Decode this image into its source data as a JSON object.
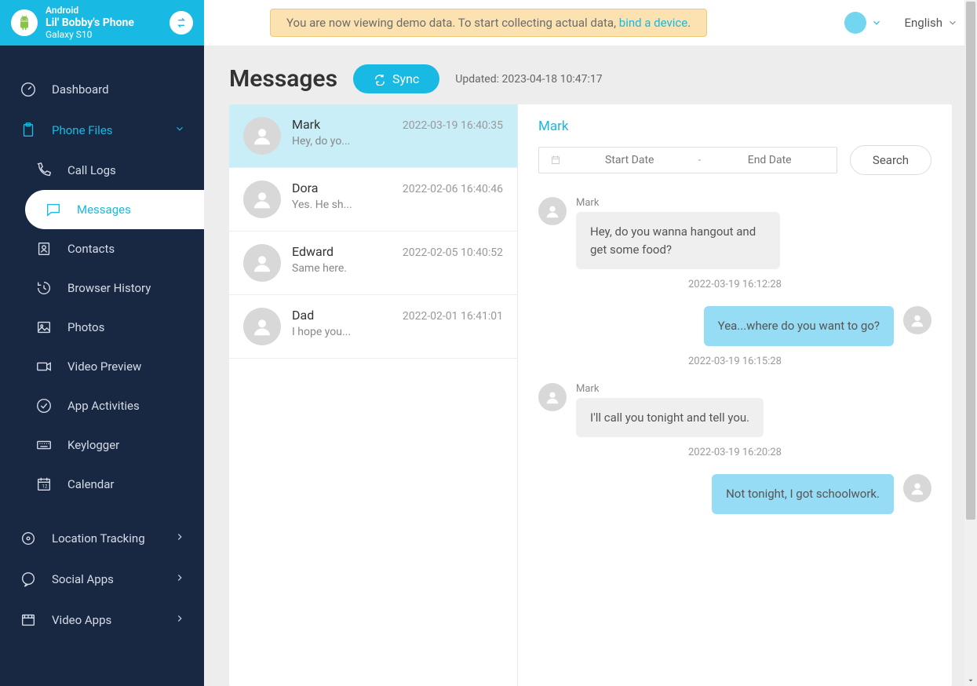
{
  "device": {
    "os": "Android",
    "name": "Lil' Bobby's Phone",
    "model": "Galaxy S10"
  },
  "topbar": {
    "demo_prefix": "You are now viewing demo data. To start collecting actual data, ",
    "demo_link": "bind a device",
    "demo_suffix": ".",
    "language": "English"
  },
  "nav": {
    "dashboard": "Dashboard",
    "phone_files": "Phone Files",
    "call_logs": "Call Logs",
    "messages": "Messages",
    "contacts": "Contacts",
    "browser_history": "Browser History",
    "photos": "Photos",
    "video_preview": "Video Preview",
    "app_activities": "App Activities",
    "keylogger": "Keylogger",
    "calendar": "Calendar",
    "location_tracking": "Location Tracking",
    "social_apps": "Social Apps",
    "video_apps": "Video Apps"
  },
  "page": {
    "title": "Messages",
    "sync": "Sync",
    "updated": "Updated: 2023-04-18 10:47:17"
  },
  "threads": [
    {
      "name": "Mark",
      "preview": "Hey, do yo...",
      "time": "2022-03-19 16:40:35"
    },
    {
      "name": "Dora",
      "preview": "Yes. He sh...",
      "time": "2022-02-06 16:40:46"
    },
    {
      "name": "Edward",
      "preview": "Same here.",
      "time": "2022-02-05 10:40:52"
    },
    {
      "name": "Dad",
      "preview": "I hope you...",
      "time": "2022-02-01 16:41:01"
    }
  ],
  "chat": {
    "contact": "Mark",
    "start_ph": "Start Date",
    "end_ph": "End Date",
    "search": "Search",
    "messages": [
      {
        "dir": "in",
        "sender": "Mark",
        "text": "Hey, do you wanna hangout and get some food?",
        "ts": "2022-03-19 16:12:28"
      },
      {
        "dir": "out",
        "text": "Yea...where do you want to go?",
        "ts": "2022-03-19 16:15:28"
      },
      {
        "dir": "in",
        "sender": "Mark",
        "text": "I'll call you tonight and tell you.",
        "ts": "2022-03-19 16:20:28"
      },
      {
        "dir": "out",
        "text": "Not tonight, I got schoolwork.",
        "ts": ""
      }
    ]
  }
}
